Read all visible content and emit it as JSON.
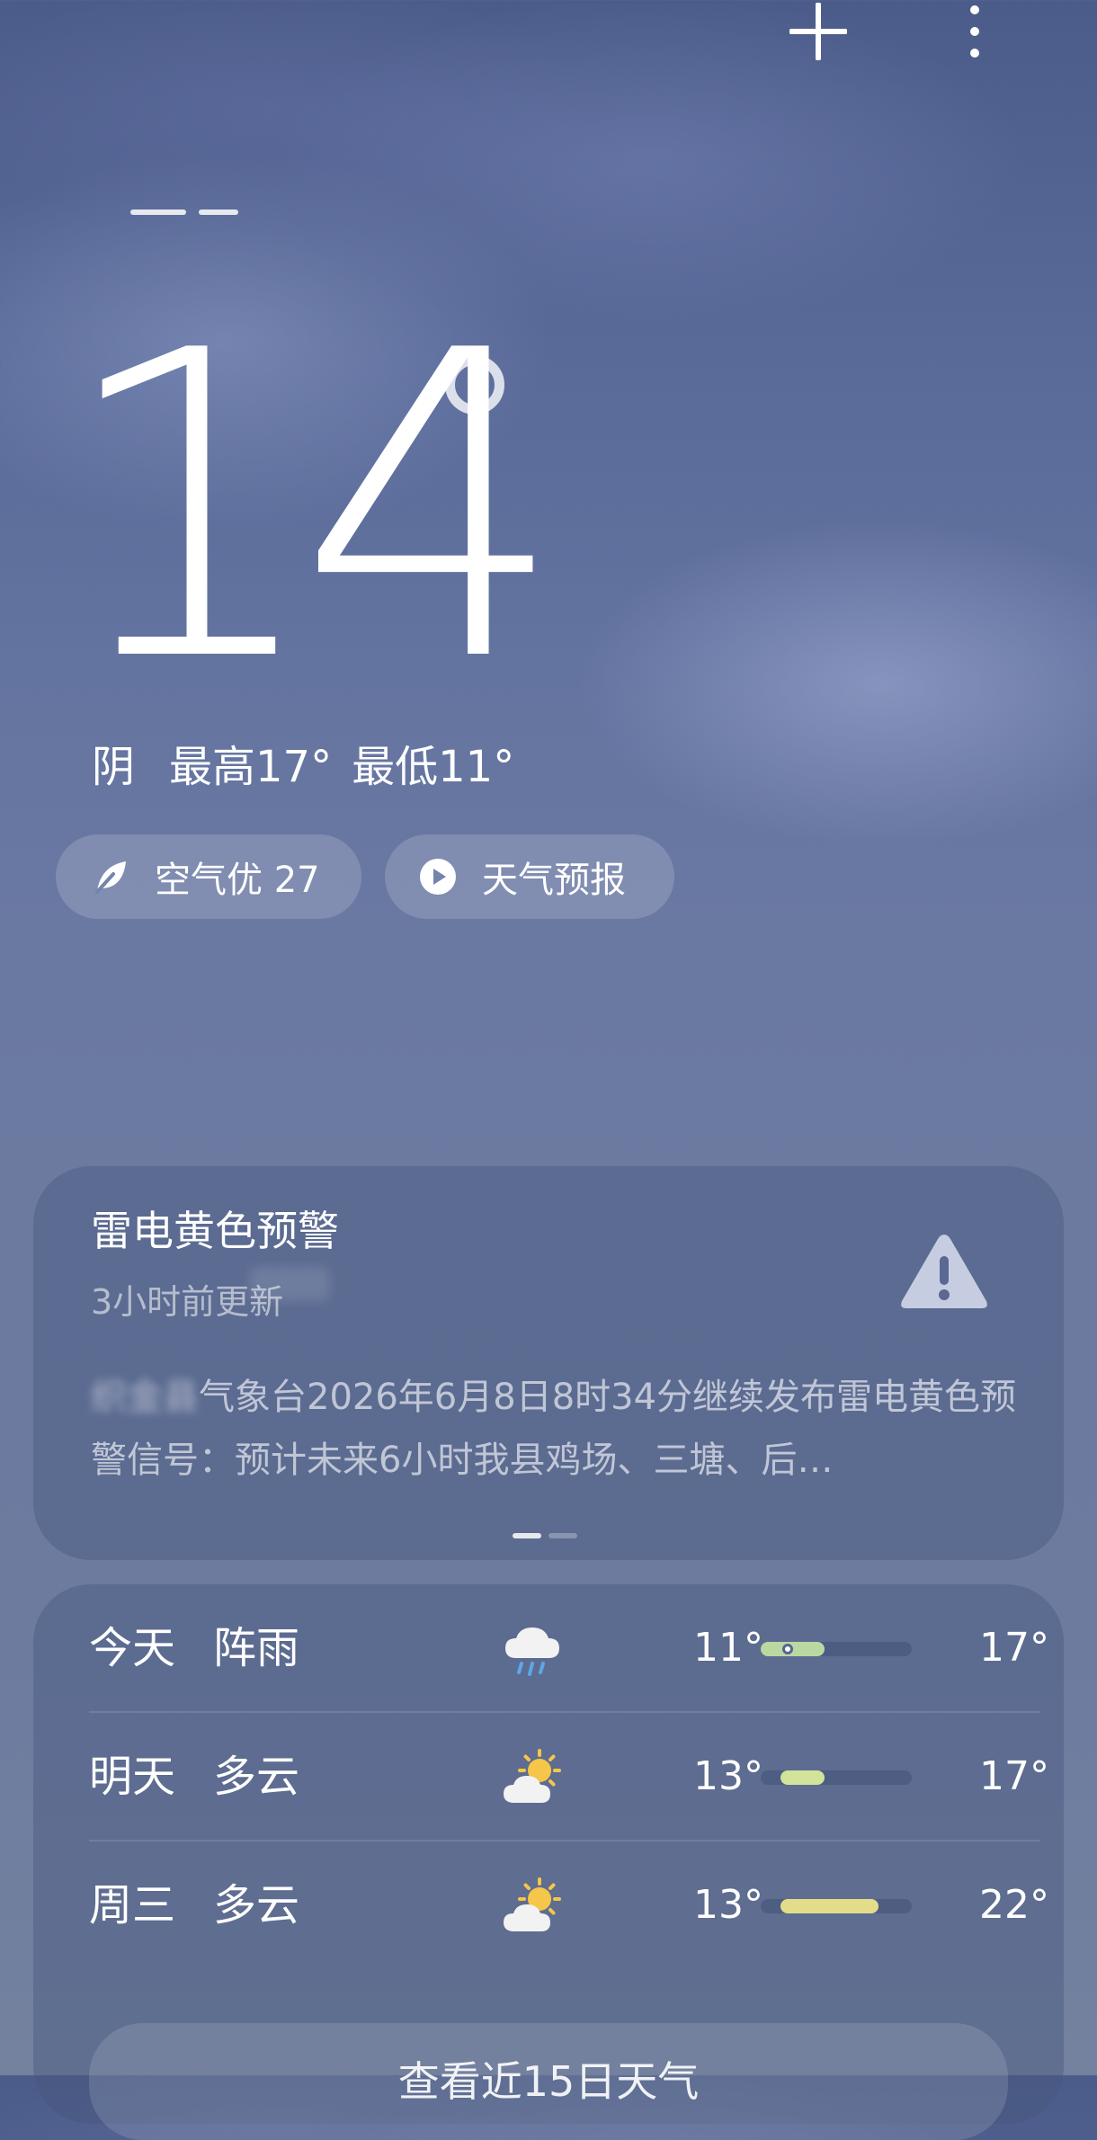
{
  "topbar": {
    "add_icon": "plus-icon",
    "more_icon": "more-vertical-icon"
  },
  "current": {
    "temperature": "14",
    "degree_symbol": "°",
    "condition": "阴",
    "high": "最高17°",
    "low": "最低11°"
  },
  "pills": {
    "air": {
      "icon": "leaf-icon",
      "label": "空气优 27"
    },
    "forecast": {
      "icon": "play-icon",
      "label": "天气预报"
    }
  },
  "alert": {
    "title": "雷电黄色预警",
    "updated": "3小时前更新",
    "icon": "warning-triangle-icon",
    "org": "织金县",
    "body": "气象台2026年6月8日8时34分继续发布雷电黄色预警信号：预计未来6小时我县鸡场、三塘、后…",
    "page_count": 2,
    "active_page": 1
  },
  "forecast": {
    "days": [
      {
        "day": "今天",
        "condition": "阵雨",
        "icon": "rain-cloud-icon",
        "low": "11°",
        "high": "17°",
        "bar": {
          "from": 0.0,
          "to": 0.42,
          "color": "#bcd8a2",
          "current": 0.18
        }
      },
      {
        "day": "明天",
        "condition": "多云",
        "icon": "partly-cloudy-icon",
        "low": "13°",
        "high": "17°",
        "bar": {
          "from": 0.13,
          "to": 0.42,
          "color": "#d2e39a"
        }
      },
      {
        "day": "周三",
        "condition": "多云",
        "icon": "partly-cloudy-icon",
        "low": "13°",
        "high": "22°",
        "bar": {
          "from": 0.13,
          "to": 0.78,
          "color": "#e3dd8a"
        }
      }
    ],
    "more_label": "查看近15日天气"
  },
  "colors": {
    "card_bg": "#46557d",
    "alert_icon": "#c7cde0",
    "sun": "#f6c64a",
    "cloud": "#f2f2f2"
  }
}
